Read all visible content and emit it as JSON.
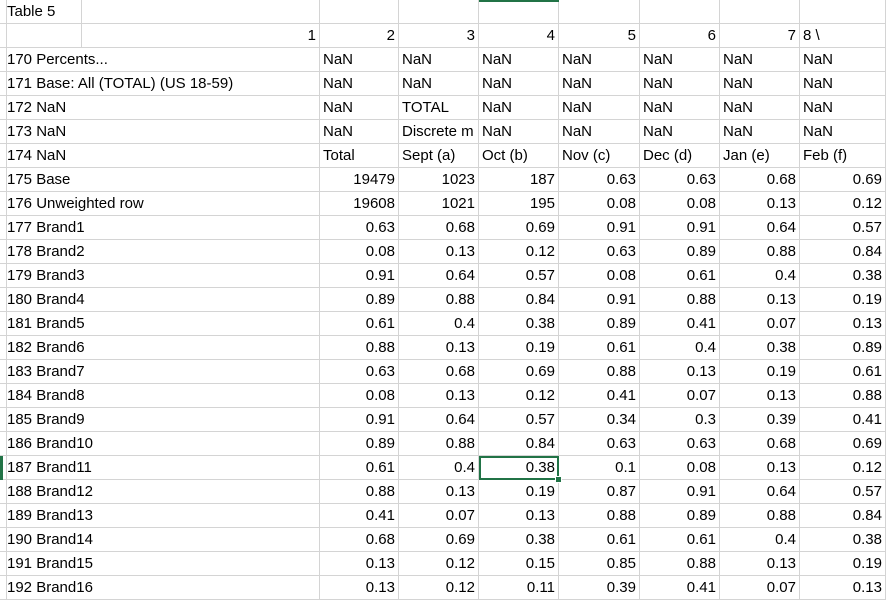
{
  "sheet": {
    "title": "Table 5",
    "col_headers": [
      "1",
      "2",
      "3",
      "4",
      "5",
      "6",
      "7",
      "8  \\"
    ],
    "rows": [
      {
        "a": "170 Percents...",
        "v": [
          "NaN",
          "NaN",
          "NaN",
          "NaN",
          "NaN",
          "NaN",
          "NaN"
        ]
      },
      {
        "a": "171 Base: All (TOTAL) (US 18-59)",
        "v": [
          "NaN",
          "NaN",
          "NaN",
          "NaN",
          "NaN",
          "NaN",
          "NaN"
        ]
      },
      {
        "a": "172 NaN",
        "v": [
          "NaN",
          "TOTAL",
          "NaN",
          "NaN",
          "NaN",
          "NaN",
          "NaN"
        ]
      },
      {
        "a": "173 NaN",
        "v": [
          "NaN",
          "Discrete m",
          "NaN",
          "NaN",
          "NaN",
          "NaN",
          "NaN"
        ]
      },
      {
        "a": "174 NaN",
        "v": [
          "Total",
          "Sept (a)",
          "Oct (b)",
          "Nov (c)",
          "Dec (d)",
          "Jan (e)",
          "Feb (f)"
        ]
      },
      {
        "a": "175 Base",
        "v": [
          "19479",
          "1023",
          "187",
          "0.63",
          "0.63",
          "0.68",
          "0.69"
        ]
      },
      {
        "a": "176 Unweighted row",
        "v": [
          "19608",
          "1021",
          "195",
          "0.08",
          "0.08",
          "0.13",
          "0.12"
        ]
      },
      {
        "a": "177 Brand1",
        "v": [
          "0.63",
          "0.68",
          "0.69",
          "0.91",
          "0.91",
          "0.64",
          "0.57"
        ]
      },
      {
        "a": "178 Brand2",
        "v": [
          "0.08",
          "0.13",
          "0.12",
          "0.63",
          "0.89",
          "0.88",
          "0.84"
        ]
      },
      {
        "a": "179 Brand3",
        "v": [
          "0.91",
          "0.64",
          "0.57",
          "0.08",
          "0.61",
          "0.4",
          "0.38"
        ]
      },
      {
        "a": "180 Brand4",
        "v": [
          "0.89",
          "0.88",
          "0.84",
          "0.91",
          "0.88",
          "0.13",
          "0.19"
        ]
      },
      {
        "a": "181 Brand5",
        "v": [
          "0.61",
          "0.4",
          "0.38",
          "0.89",
          "0.41",
          "0.07",
          "0.13"
        ]
      },
      {
        "a": "182 Brand6",
        "v": [
          "0.88",
          "0.13",
          "0.19",
          "0.61",
          "0.4",
          "0.38",
          "0.89"
        ]
      },
      {
        "a": "183 Brand7",
        "v": [
          "0.63",
          "0.68",
          "0.69",
          "0.88",
          "0.13",
          "0.19",
          "0.61"
        ]
      },
      {
        "a": "184 Brand8",
        "v": [
          "0.08",
          "0.13",
          "0.12",
          "0.41",
          "0.07",
          "0.13",
          "0.88"
        ]
      },
      {
        "a": "185 Brand9",
        "v": [
          "0.91",
          "0.64",
          "0.57",
          "0.34",
          "0.3",
          "0.39",
          "0.41"
        ]
      },
      {
        "a": "186 Brand10",
        "v": [
          "0.89",
          "0.88",
          "0.84",
          "0.63",
          "0.63",
          "0.68",
          "0.69"
        ]
      },
      {
        "a": "187 Brand11",
        "v": [
          "0.61",
          "0.4",
          "0.38",
          "0.1",
          "0.08",
          "0.13",
          "0.12"
        ]
      },
      {
        "a": "188 Brand12",
        "v": [
          "0.88",
          "0.13",
          "0.19",
          "0.87",
          "0.91",
          "0.64",
          "0.57"
        ]
      },
      {
        "a": "189 Brand13",
        "v": [
          "0.41",
          "0.07",
          "0.13",
          "0.88",
          "0.89",
          "0.88",
          "0.84"
        ]
      },
      {
        "a": "190 Brand14",
        "v": [
          "0.68",
          "0.69",
          "0.38",
          "0.61",
          "0.61",
          "0.4",
          "0.38"
        ]
      },
      {
        "a": "191 Brand15",
        "v": [
          "0.13",
          "0.12",
          "0.15",
          "0.85",
          "0.88",
          "0.13",
          "0.19"
        ]
      },
      {
        "a": "192 Brand16",
        "v": [
          "0.13",
          "0.12",
          "0.11",
          "0.39",
          "0.41",
          "0.07",
          "0.13"
        ]
      }
    ]
  },
  "colors": {
    "selection": "#217346",
    "gridline": "#d4d4d4"
  }
}
